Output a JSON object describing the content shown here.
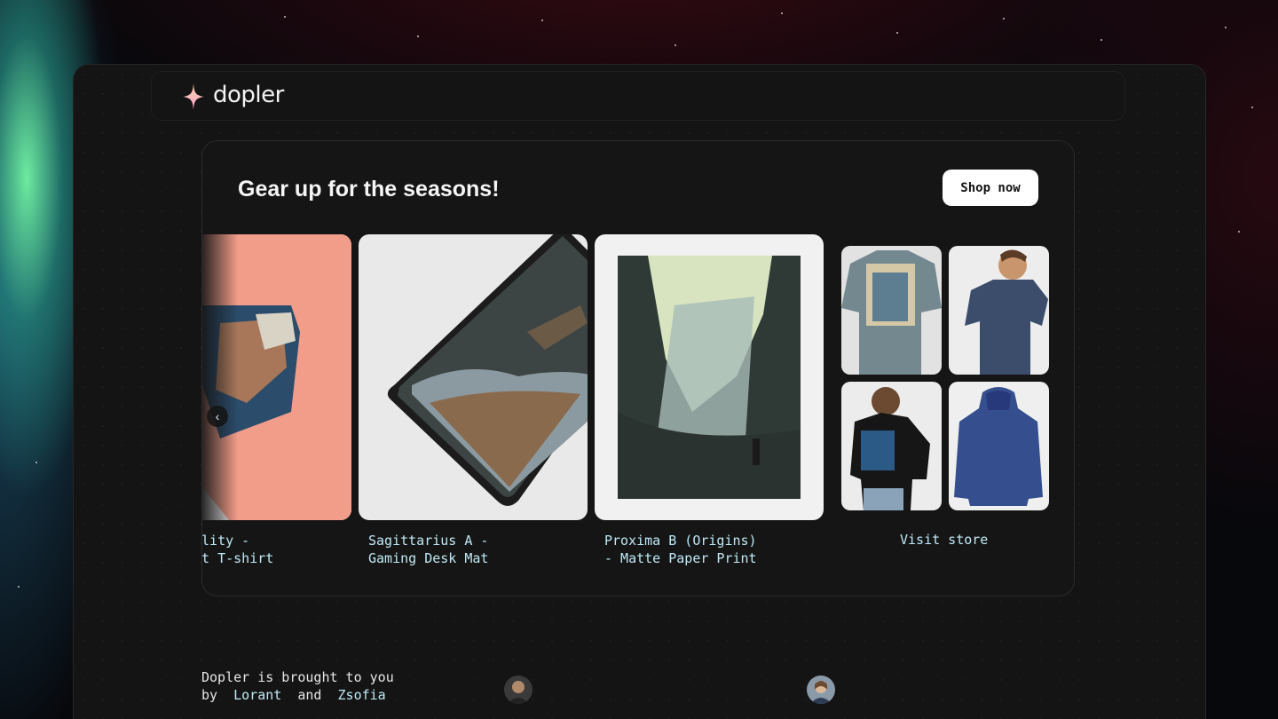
{
  "app": {
    "name": "dopler"
  },
  "promo": {
    "title": "Gear up for the seasons!",
    "shop_label": "Shop now",
    "products": [
      {
        "line1": "ality -",
        "line2": "ht T-shirt"
      },
      {
        "line1": "Sagittarius A -",
        "line2": "Gaming Desk Mat"
      },
      {
        "line1": "Proxima B (Origins)",
        "line2": "- Matte Paper Print"
      }
    ],
    "visit_label": "Visit store"
  },
  "footer": {
    "line1": "Dopler is brought to you",
    "by": "by",
    "and": "and",
    "author1": "Lorant",
    "author2": "Zsofia"
  },
  "colors": {
    "accent_text": "#bfe9f6",
    "background": "#141414",
    "button_bg": "#ffffff"
  },
  "icons": [
    "sparkle-logo-icon",
    "chevron-left-icon"
  ]
}
